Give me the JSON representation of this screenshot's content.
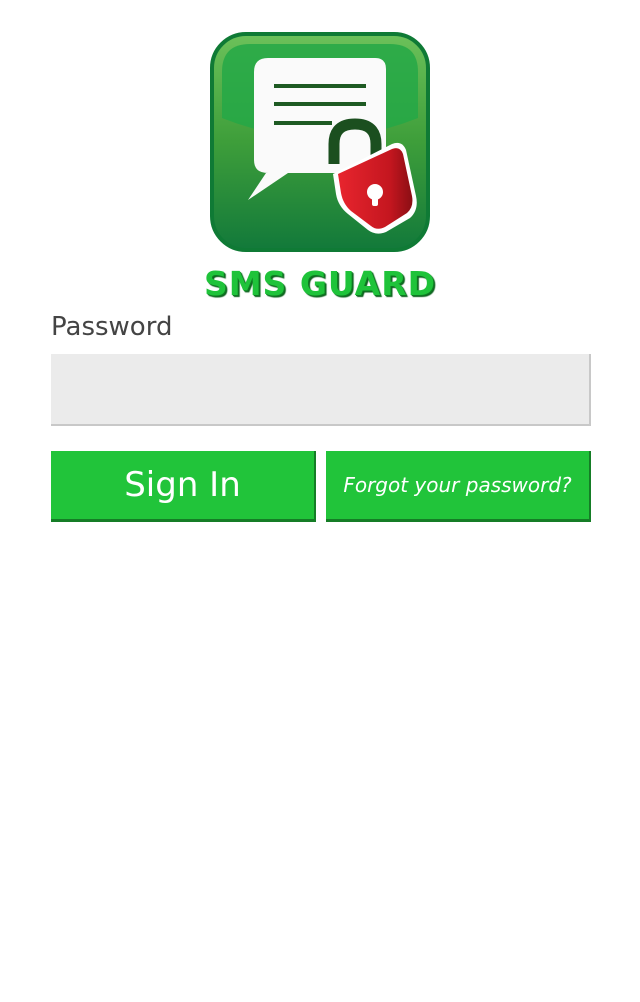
{
  "app": {
    "brand_title": "SMS GUARD",
    "logo_icon": "chat-lock-icon"
  },
  "login": {
    "password_label": "Password",
    "password_value": "",
    "password_placeholder": "",
    "signin_label": "Sign In",
    "forgot_label": "Forgot your password?"
  },
  "colors": {
    "accent_green": "#21c43a",
    "accent_green_dark": "#157d26",
    "lock_red": "#e0242d",
    "input_bg": "#ebebeb",
    "label_text": "#444444"
  }
}
